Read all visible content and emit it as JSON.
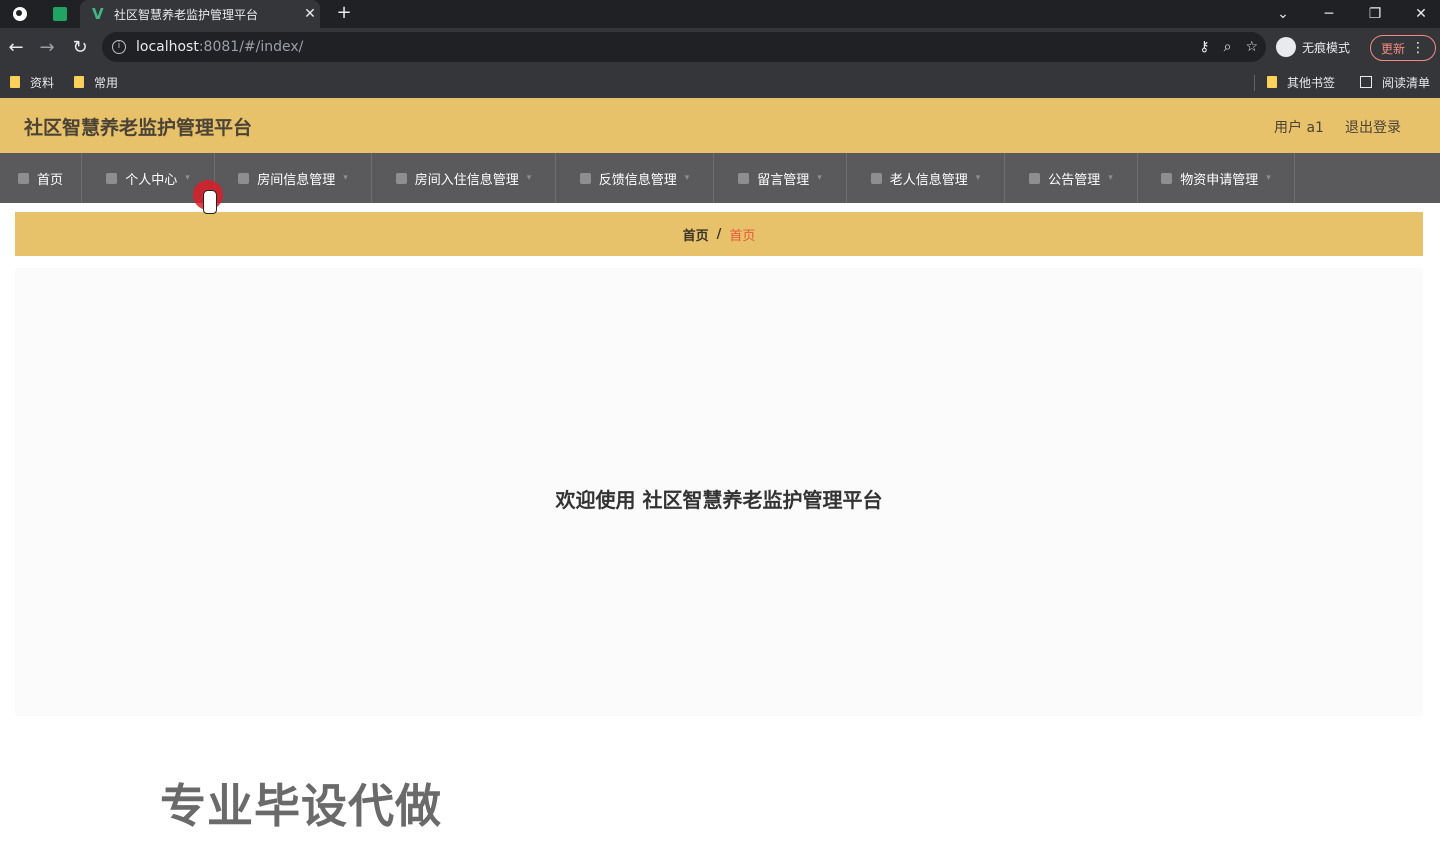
{
  "browser": {
    "tab_title": "社区智慧养老监护管理平台",
    "tab_close": "✕",
    "new_tab": "+",
    "url_host": "localhost",
    "url_rest": ":8081/#/index/",
    "incognito_label": "无痕模式",
    "update_label": "更新",
    "window_controls": [
      "⌄",
      "─",
      "❐",
      "✕"
    ],
    "bookmarks": {
      "left": [
        "资料",
        "常用"
      ],
      "other_bookmarks": "其他书签",
      "reading_list": "阅读清单"
    }
  },
  "header": {
    "title": "社区智慧养老监护管理平台",
    "user": "用户 a1",
    "logout": "退出登录"
  },
  "menu": {
    "items": [
      {
        "label": "首页",
        "icon": "home-icon"
      },
      {
        "label": "个人中心",
        "icon": "user-icon"
      },
      {
        "label": "房间信息管理",
        "icon": "briefcase-icon"
      },
      {
        "label": "房间入住信息管理",
        "icon": "chat-icon"
      },
      {
        "label": "反馈信息管理",
        "icon": "clipboard-icon"
      },
      {
        "label": "留言管理",
        "icon": "document-icon"
      },
      {
        "label": "老人信息管理",
        "icon": "monitor-icon"
      },
      {
        "label": "公告管理",
        "icon": "mail-icon"
      },
      {
        "label": "物资申请管理",
        "icon": "box-icon"
      }
    ]
  },
  "breadcrumb": {
    "home": "首页",
    "separator": "/",
    "current": "首页"
  },
  "main": {
    "welcome": "欢迎使用 社区智慧养老监护管理平台"
  },
  "overlay": {
    "watermark": "专业毕设代做"
  },
  "colors": {
    "header_bg": "#e8c26b",
    "menu_bg": "#5a595c",
    "breadcrumb_current": "#e6573b"
  }
}
